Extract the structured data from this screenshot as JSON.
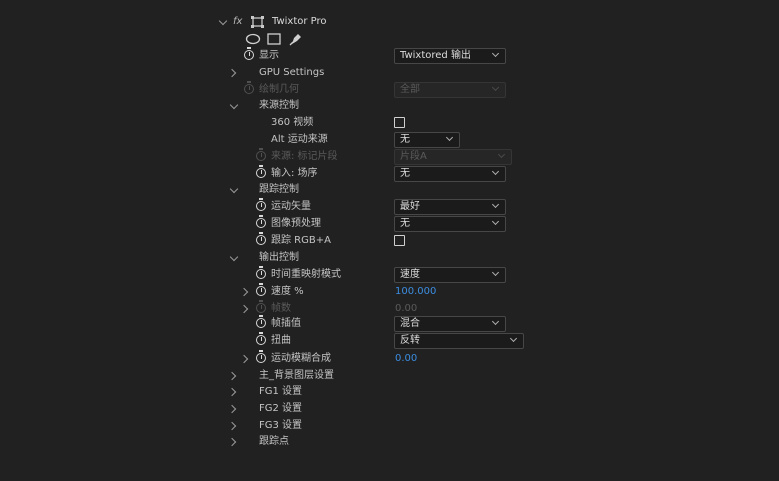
{
  "effect": {
    "fx_label": "fx",
    "name": "Twixtor Pro"
  },
  "display": {
    "label": "显示",
    "value": "Twixtored 输出"
  },
  "gpu": {
    "label": "GPU Settings"
  },
  "draw_geometry": {
    "label": "绘制几何",
    "value": "全部"
  },
  "source_control": {
    "label": "来源控制",
    "vr360": {
      "label": "360 视频"
    },
    "alt_motion": {
      "label": "Alt 运动来源",
      "value": "无"
    },
    "source_mark": {
      "label": "来源: 标记片段",
      "value": "片段A"
    },
    "input_field": {
      "label": "输入: 场序",
      "value": "无"
    }
  },
  "tracking_control": {
    "label": "跟踪控制",
    "motion_vectors": {
      "label": "运动矢量",
      "value": "最好"
    },
    "image_prep": {
      "label": "图像预处理",
      "value": "无"
    },
    "track_rgba": {
      "label": "跟踪 RGB+A"
    }
  },
  "output_control": {
    "label": "输出控制",
    "time_remap": {
      "label": "时间重映射模式",
      "value": "速度"
    },
    "speed": {
      "label": "速度 %",
      "value": "100.000"
    },
    "frames": {
      "label": "帧数",
      "value": "0.00"
    },
    "frame_interp": {
      "label": "帧插值",
      "value": "混合"
    },
    "warp": {
      "label": "扭曲",
      "value": "反转"
    },
    "motion_blur": {
      "label": "运动模糊合成",
      "value": "0.00"
    }
  },
  "groups": [
    {
      "label": "主_背景图层设置"
    },
    {
      "label": "FG1 设置"
    },
    {
      "label": "FG2 设置"
    },
    {
      "label": "FG3 设置"
    },
    {
      "label": "跟踪点"
    }
  ]
}
